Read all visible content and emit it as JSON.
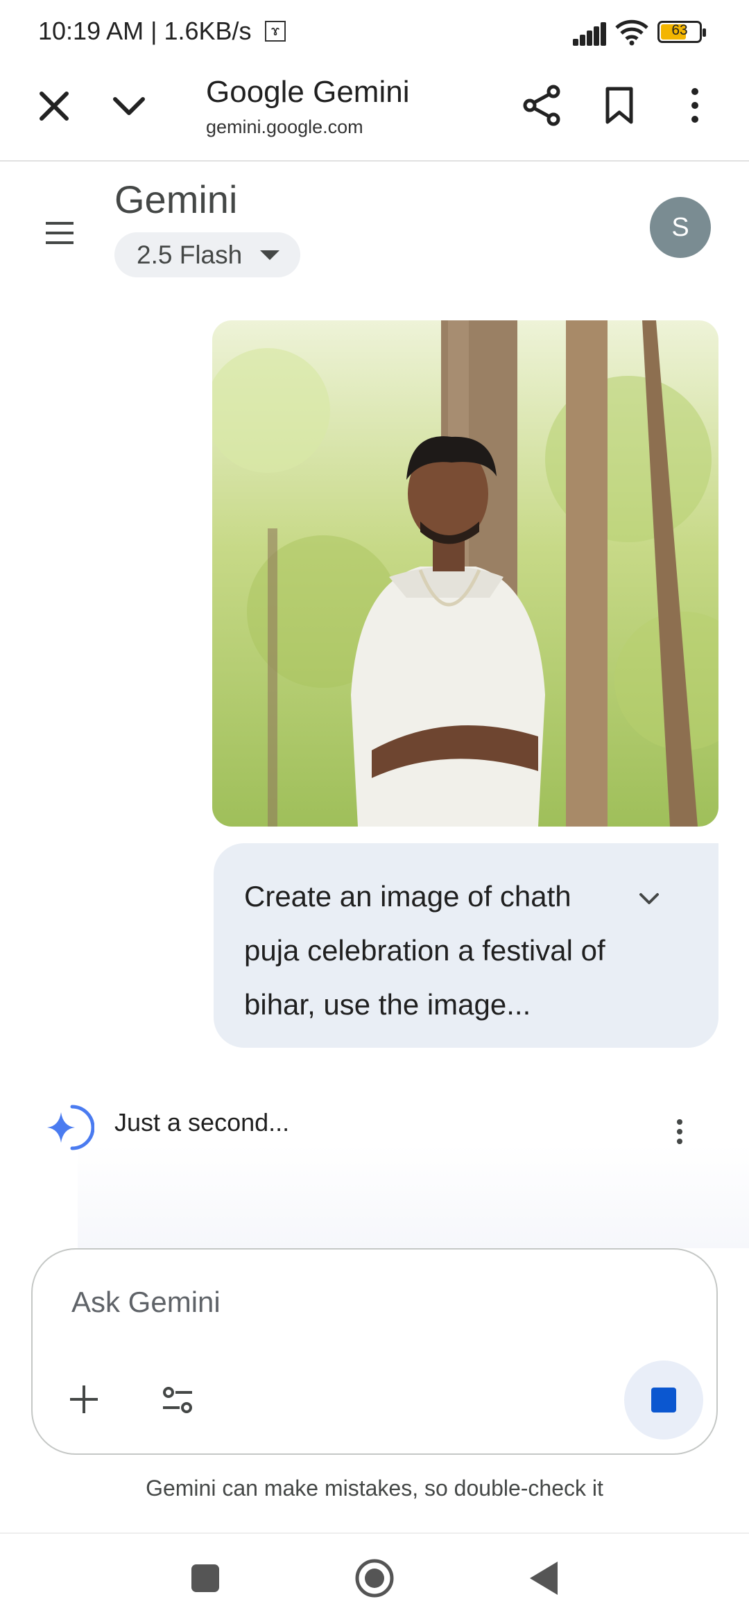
{
  "status_bar": {
    "time_speed": "10:19 AM | 1.6KB/s",
    "battery": "63"
  },
  "browser": {
    "title": "Google Gemini",
    "url": "gemini.google.com"
  },
  "app": {
    "name": "Gemini",
    "model": "2.5 Flash",
    "avatar_initial": "S"
  },
  "chat": {
    "user_prompt": "Create an image of chath puja celebration a festival of bihar, use the image...",
    "response_status": "Just a second..."
  },
  "composer": {
    "placeholder": "Ask Gemini",
    "disclaimer": "Gemini can make mistakes, so double-check it"
  },
  "colors": {
    "accent": "#0b57d0",
    "bubble": "#e9eef5",
    "avatar": "#7a8c92"
  }
}
